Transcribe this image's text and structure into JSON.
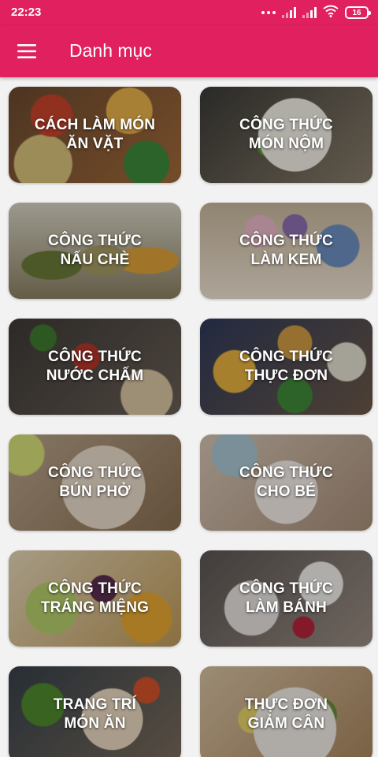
{
  "status_bar": {
    "time": "22:23",
    "battery": "16"
  },
  "app_bar": {
    "title": "Danh mục"
  },
  "categories": [
    {
      "line1": "CÁCH LÀM MÓN",
      "line2": "ĂN VẶT"
    },
    {
      "line1": "CÔNG THỨC",
      "line2": "MÓN NỘM"
    },
    {
      "line1": "CÔNG THỨC",
      "line2": "NẤU CHÈ"
    },
    {
      "line1": "CÔNG THỨC",
      "line2": "LÀM KEM"
    },
    {
      "line1": "CÔNG THỨC",
      "line2": "NƯỚC CHẤM"
    },
    {
      "line1": "CÔNG THỨC",
      "line2": "THỰC ĐƠN"
    },
    {
      "line1": "CÔNG THỨC",
      "line2": "BÚN PHỞ"
    },
    {
      "line1": "CÔNG THỨC",
      "line2": "CHO BÉ"
    },
    {
      "line1": "CÔNG THỨC",
      "line2": "TRÁNG MIỆNG"
    },
    {
      "line1": "CÔNG THỨC",
      "line2": "LÀM BÁNH"
    },
    {
      "line1": "TRANG TRÍ",
      "line2": "MÓN ĂN"
    },
    {
      "line1": "THỰC ĐƠN",
      "line2": "GIẢM CÂN"
    }
  ],
  "colors": {
    "primary": "#e0205f",
    "background": "#f2f2f2"
  },
  "icons": {
    "menu": "hamburger-menu-icon",
    "wifi": "wifi-icon",
    "signal": "signal-icon",
    "battery": "battery-icon"
  }
}
